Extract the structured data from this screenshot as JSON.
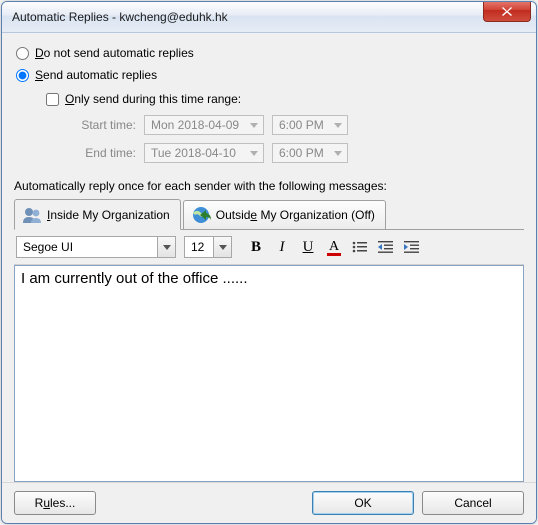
{
  "titlebar": {
    "title": "Automatic Replies - kwcheng@eduhk.hk"
  },
  "options": {
    "do_not_send_prefix": "D",
    "do_not_send_rest": "o not send automatic replies",
    "send_prefix": "S",
    "send_rest": "end automatic replies",
    "only_range_prefix": "O",
    "only_range_rest": "nly send during this time range:",
    "start_label": "Start time:",
    "end_label": "End time:",
    "start_date": "Mon 2018-04-09",
    "start_time": "6:00 PM",
    "end_date": "Tue 2018-04-10",
    "end_time": "6:00 PM",
    "selected": "send",
    "only_range_checked": false
  },
  "section_label": "Automatically reply once for each sender with the following messages:",
  "tabs": {
    "inside_prefix": "I",
    "inside_rest": "nside My Organization",
    "outside_prefix": "Outsid",
    "outside_u": "e",
    "outside_rest": " My Organization (Off)",
    "active": "inside"
  },
  "format": {
    "font_name": "Segoe UI",
    "font_size": "12"
  },
  "message_body": "I am currently out of the office ......",
  "buttons": {
    "rules_prefix": "R",
    "rules_u": "u",
    "rules_rest": "les...",
    "ok": "OK",
    "cancel": "Cancel"
  }
}
